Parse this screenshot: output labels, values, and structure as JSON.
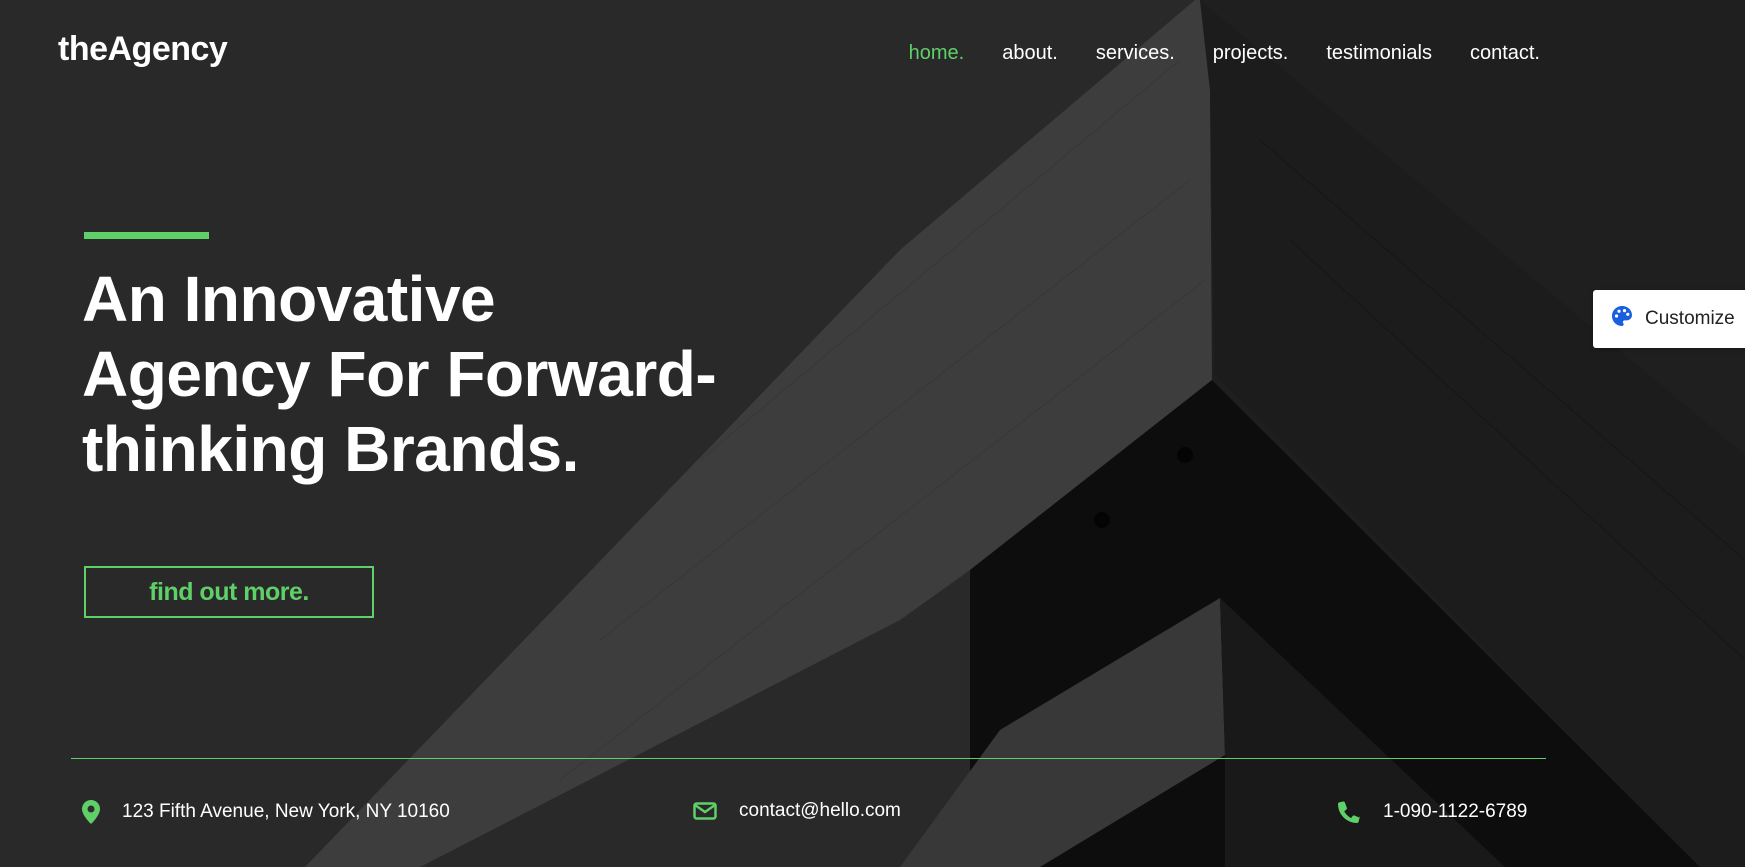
{
  "brand": {
    "logo": "theAgency"
  },
  "nav": {
    "items": [
      {
        "label": "home.",
        "active": true
      },
      {
        "label": "about.",
        "active": false
      },
      {
        "label": "services.",
        "active": false
      },
      {
        "label": "projects.",
        "active": false
      },
      {
        "label": "testimonials",
        "active": false
      },
      {
        "label": "contact.",
        "active": false
      }
    ]
  },
  "hero": {
    "headline_lines": [
      "An Innovative",
      "Agency For Forward-",
      "thinking Brands."
    ],
    "cta_label": "find out more."
  },
  "contact": {
    "address": "123 Fifth Avenue, New York, NY 10160",
    "email": "contact@hello.com",
    "phone": "1-090-1122-6789",
    "icons": [
      "map-pin-icon",
      "envelope-icon",
      "phone-icon"
    ]
  },
  "customize": {
    "label": "Customize",
    "icon": "palette-icon"
  },
  "colors": {
    "accent": "#5fcf68",
    "background": "#323232",
    "text": "#ffffff"
  }
}
